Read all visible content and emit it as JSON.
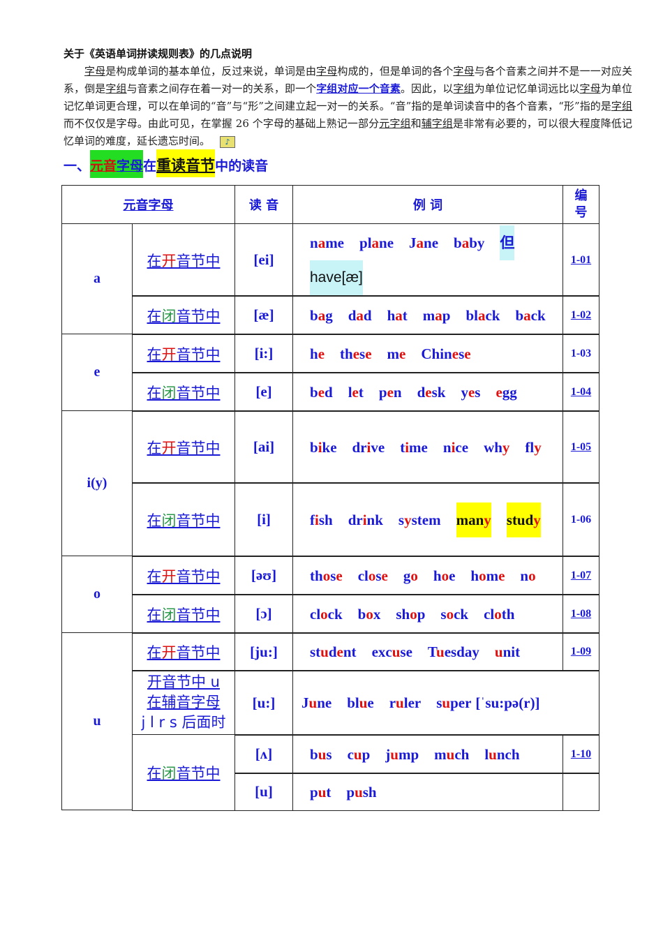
{
  "title": "关于《英语单词拼读规则表》的几点说明",
  "paragraph": [
    {
      "t": "字母",
      "s": "u"
    },
    {
      "t": "是构成单词的基本单位，反过来说，单词是由"
    },
    {
      "t": "字母",
      "s": "u"
    },
    {
      "t": "构成的，但是单词的各个"
    },
    {
      "t": "字母",
      "s": "u"
    },
    {
      "t": "与各个音素之间并不是一一对应关系，倒是"
    },
    {
      "t": "字组",
      "s": "u"
    },
    {
      "t": "与音素之间存在着一对一的关系，即一个"
    },
    {
      "t": "字组对应一个音素",
      "s": "b"
    },
    {
      "t": "。因此，以"
    },
    {
      "t": "字组",
      "s": "u"
    },
    {
      "t": "为单位记忆单词远比以"
    },
    {
      "t": "字母",
      "s": "u"
    },
    {
      "t": "为单位记忆单词更合理，可以在单词的“音”与“形”之间建立起一对一的关系。“音”指的是单词读音中的各个音素，“形”指的是"
    },
    {
      "t": "字组",
      "s": "u"
    },
    {
      "t": "而不仅仅是字母。由此可见，在掌握 26 个字母的基础上熟记一部分"
    },
    {
      "t": "元字组",
      "s": "u"
    },
    {
      "t": "和"
    },
    {
      "t": "辅字组",
      "s": "u"
    },
    {
      "t": "是非常有必要的，可以很大程度降低记忆单词的难度，延长遗忘时间。"
    }
  ],
  "heading": {
    "prefix": "一、",
    "p1": "元音",
    "p2": "字母",
    "p3": "在",
    "p4": "重读音节",
    "p5": "中的读音"
  },
  "table": {
    "headers": {
      "vowel": "元音字母",
      "sound": "读 音",
      "examples": "例 词",
      "number": "编号"
    },
    "cond_open": {
      "a": "在",
      "b": "开",
      "c": "音节中"
    },
    "cond_closed": {
      "a": "在",
      "b": "闭",
      "c": "音节中"
    },
    "letters": {
      "a": "a",
      "e": "e",
      "i": "i(y)",
      "o": "o",
      "u": "u"
    },
    "special_cond": [
      "开音节中 u",
      "在辅音字母",
      "j l r s 后面时"
    ],
    "rows": [
      {
        "sound": "[ei]",
        "words": [
          "n[a]me",
          "pl[a]ne",
          "J[a]ne",
          "b[a]by"
        ],
        "extra": [
          "但",
          "have[æ]"
        ],
        "number": "1-01"
      },
      {
        "sound": "[æ]",
        "words": [
          "b[a]g",
          "d[a]d",
          "h[a]t",
          "m[a]p",
          "bl[a]ck",
          "b[a]ck"
        ],
        "number": "1-02"
      },
      {
        "sound": "[i:]",
        "words": [
          "h[e]",
          "th[e]s[e]",
          "m[e]",
          "Chin[e]s[e]"
        ],
        "number": "1-03"
      },
      {
        "sound": "[e]",
        "words": [
          "b[e]d",
          "l[e]t",
          "p[e]n",
          "d[e]sk",
          "y[e]s",
          "[e]gg"
        ],
        "number": "1-04"
      },
      {
        "sound": "[ai]",
        "words": [
          "b[i]ke",
          "dr[i]ve",
          "t[i]me",
          "n[i]ce",
          "wh[y]",
          "fl[y]"
        ],
        "number": "1-05"
      },
      {
        "sound": "[i]",
        "words": [
          "f[i]sh",
          "dr[i]nk",
          "s[y]stem"
        ],
        "hl_words": [
          "man[y]",
          "stud[y]"
        ],
        "number": "1-06"
      },
      {
        "sound": "[əʊ]",
        "words": [
          "th[o]s[e]",
          "cl[o]s[e]",
          "g[o]",
          "h[o]e",
          "h[o]m[e]",
          "n[o]"
        ],
        "number": "1-07"
      },
      {
        "sound": "[ɔ]",
        "words": [
          "cl[o]ck",
          "b[o]x",
          "sh[o]p",
          "s[o]ck",
          "cl[o]th"
        ],
        "number": "1-08"
      },
      {
        "sound": "[ju:]",
        "words": [
          "st[u]d[e]nt",
          "exc[u]se",
          "T[u]esday",
          "[u]nit"
        ],
        "number": "1-09"
      },
      {
        "sound": "[u:]",
        "words": [
          "J[u]ne",
          "bl[u]e",
          "r[u]ler",
          "s[u]per",
          "[ˈsu:pə(r)]"
        ],
        "number": ""
      },
      {
        "sound": "[ʌ]",
        "words": [
          "b[u]s",
          "c[u]p",
          "j[u]mp",
          "m[u]ch",
          "l[u]nch"
        ],
        "number": "1-10"
      },
      {
        "sound": "[u]",
        "words": [
          "p[u]t",
          "p[u]sh"
        ],
        "number": ""
      }
    ]
  },
  "colors": {
    "blue": "#1a1ad6",
    "red": "#e01010",
    "green": "#22dd22",
    "yellow": "#ffff00"
  }
}
